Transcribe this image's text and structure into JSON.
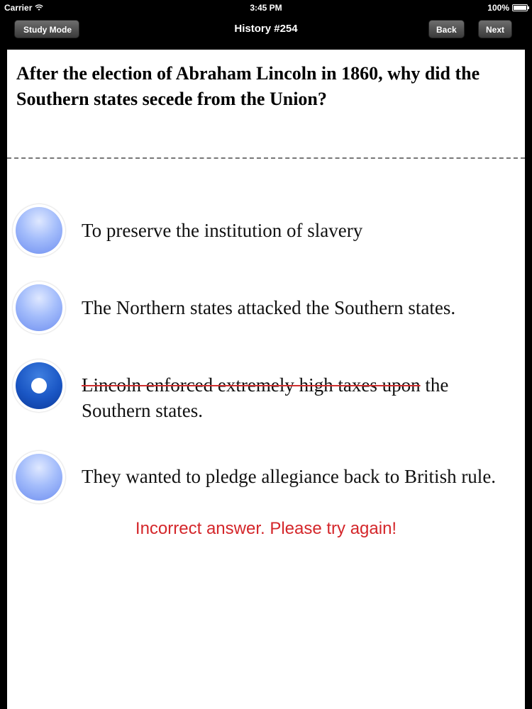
{
  "status_bar": {
    "carrier": "Carrier",
    "time": "3:45 PM",
    "battery": "100%"
  },
  "nav": {
    "title": "History #254",
    "study_mode_label": "Study Mode",
    "back_label": "Back",
    "next_label": "Next"
  },
  "question": {
    "text": "After the election of Abraham Lincoln in 1860, why did the Southern states secede from the Union?"
  },
  "options": [
    {
      "text": "To preserve the institution of slavery",
      "selected": false,
      "struck": false
    },
    {
      "text": "The Northern states attacked the Southern states.",
      "selected": false,
      "struck": false
    },
    {
      "text_struck": "Lincoln enforced extremely high taxes upon",
      "text_rest_line1": " the",
      "text_line2": "Southern states.",
      "selected": true,
      "struck": true
    },
    {
      "text": "They wanted to pledge allegiance back to British rule.",
      "selected": false,
      "struck": false
    }
  ],
  "feedback": {
    "text": "Incorrect answer. Please try again!",
    "color": "#d4262a"
  },
  "colors": {
    "radio_unselected": "#a4bdfb",
    "radio_selected": "#1a56c4",
    "strike": "#d03030"
  }
}
